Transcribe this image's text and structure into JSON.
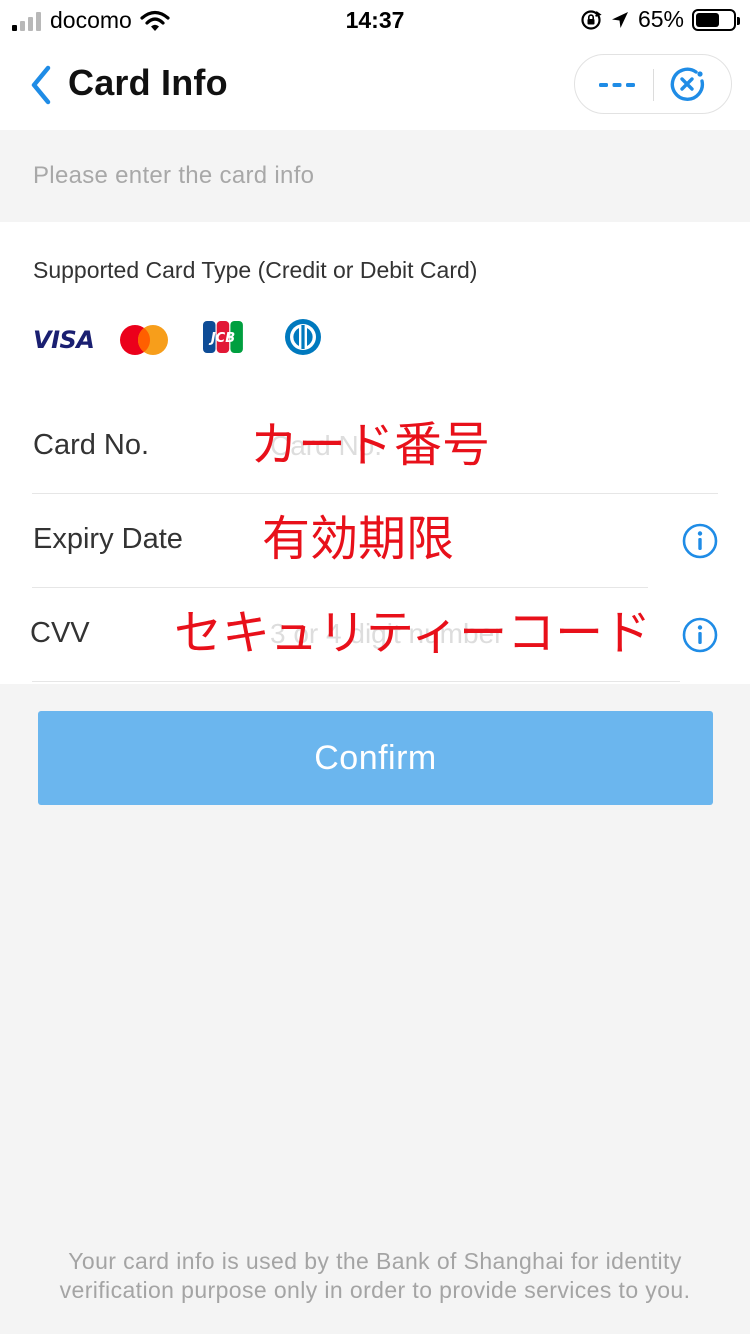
{
  "status_bar": {
    "carrier": "docomo",
    "time": "14:37",
    "battery_text": "65%",
    "battery_level": 0.65,
    "icons": [
      "signal-icon",
      "wifi-icon",
      "rotation-lock-icon",
      "location-arrow-icon",
      "battery-icon"
    ]
  },
  "nav": {
    "title": "Card Info",
    "back_icon": "chevron-left-icon",
    "more_icon": "more-dots-icon",
    "close_icon": "close-circle-icon"
  },
  "hint": "Please enter the card info",
  "card_types": {
    "label": "Supported Card Type (Credit or Debit Card)",
    "visa": "VISA",
    "logos": [
      "visa-logo",
      "mastercard-logo",
      "jcb-logo",
      "diners-club-logo"
    ]
  },
  "fields": {
    "card_no": {
      "label": "Card No.",
      "placeholder": "Card No.",
      "annotation": "カード番号"
    },
    "expiry": {
      "label": "Expiry Date",
      "placeholder": "",
      "annotation": "有効期限"
    },
    "cvv": {
      "label": "CVV",
      "placeholder": "3 or 4 digit number",
      "annotation": "セキュリティーコード"
    }
  },
  "confirm_label": "Confirm",
  "footer_line1": "Your card info is used by the Bank of Shanghai for identity",
  "footer_line2": "verification purpose only in order to provide services to you.",
  "colors": {
    "accent": "#1f8ce6",
    "button": "#6bb6ee",
    "annotation": "#e8101a",
    "background": "#f4f4f4"
  }
}
